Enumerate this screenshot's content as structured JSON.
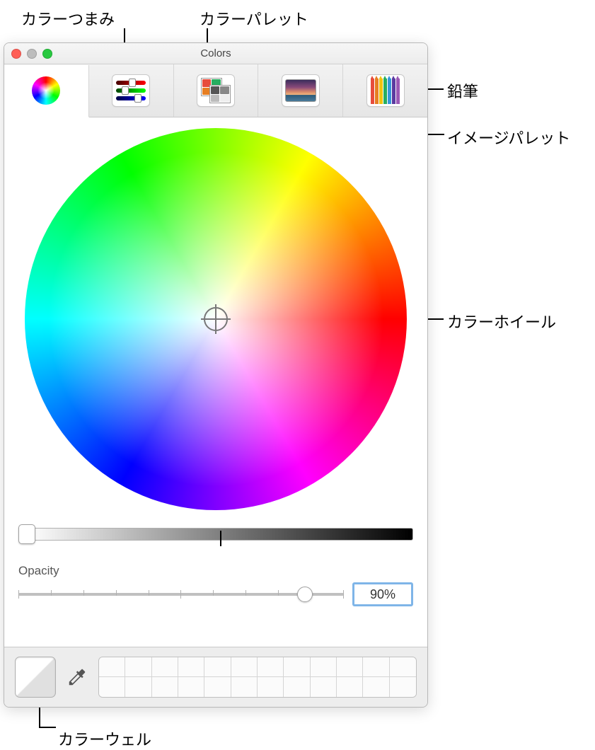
{
  "callouts": {
    "color_sliders": "カラーつまみ",
    "color_palettes": "カラーパレット",
    "pencils": "鉛筆",
    "image_palettes": "イメージパレット",
    "color_wheel": "カラーホイール",
    "color_well": "カラーウェル"
  },
  "window": {
    "title": "Colors"
  },
  "toolbar": {
    "tabs": [
      {
        "name": "color-wheel-tab",
        "label": "Color Wheel"
      },
      {
        "name": "color-sliders-tab",
        "label": "Color Sliders"
      },
      {
        "name": "color-palettes-tab",
        "label": "Color Palettes"
      },
      {
        "name": "image-palettes-tab",
        "label": "Image Palettes"
      },
      {
        "name": "pencils-tab",
        "label": "Pencils"
      }
    ]
  },
  "opacity": {
    "label": "Opacity",
    "value": "90%"
  },
  "colors": {
    "close": "#ff5f57",
    "minimize": "#bdbdbd",
    "zoom": "#28c940",
    "input_focus": "#7fb5e8"
  }
}
